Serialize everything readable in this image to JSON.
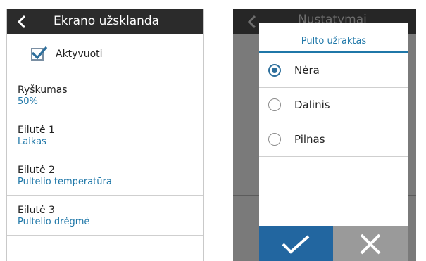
{
  "left_screen": {
    "title": "Ekrano užsklanda",
    "back_icon": "chevron-left-icon",
    "checkbox": {
      "label": "Aktyvuoti",
      "checked": true
    },
    "rows": [
      {
        "title": "Ryškumas",
        "value": "50%"
      },
      {
        "title": "Eilutė 1",
        "value": "Laikas"
      },
      {
        "title": "Eilutė 2",
        "value": "Pultelio temperatūra"
      },
      {
        "title": "Eilutė 3",
        "value": "Pultelio drėgmė"
      }
    ]
  },
  "right_screen": {
    "background_title": "Nustatymai",
    "dialog": {
      "title": "Pulto užraktas",
      "options": [
        {
          "label": "Nėra",
          "selected": true
        },
        {
          "label": "Dalinis",
          "selected": false
        },
        {
          "label": "Pilnas",
          "selected": false
        }
      ],
      "confirm_icon": "checkmark-icon",
      "cancel_icon": "close-icon"
    }
  },
  "colors": {
    "titlebar": "#2b2b2b",
    "accent": "#1f77a8",
    "confirm_button": "#2266a0",
    "cancel_button": "#9a9a9a",
    "overlay": "#7a7a7a"
  }
}
